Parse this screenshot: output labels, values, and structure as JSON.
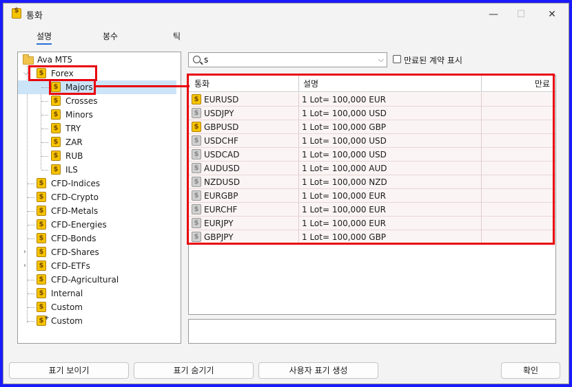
{
  "window": {
    "title": "통화",
    "minimize": "—",
    "maximize": "☐",
    "close": "✕"
  },
  "tabs": [
    "설명",
    "봉수",
    "틱"
  ],
  "tree": {
    "root": "Ava MT5",
    "forex": "Forex",
    "forex_children": [
      "Majors",
      "Crosses",
      "Minors",
      "TRY",
      "ZAR",
      "RUB",
      "ILS"
    ],
    "groups": [
      "CFD-Indices",
      "CFD-Crypto",
      "CFD-Metals",
      "CFD-Energies",
      "CFD-Bonds",
      "CFD-Shares",
      "CFD-ETFs",
      "CFD-Agricultural",
      "Internal",
      "Custom",
      "Custom"
    ]
  },
  "search": {
    "value": "s"
  },
  "expired_checkbox_label": "만료된 계약 표시",
  "table": {
    "headers": [
      "통화",
      "설명",
      "만료"
    ],
    "rows": [
      {
        "symbol": "EURUSD",
        "desc": "1 Lot= 100,000 EUR",
        "expiry": "",
        "active": true
      },
      {
        "symbol": "USDJPY",
        "desc": "1 Lot= 100,000 USD",
        "expiry": "",
        "active": false
      },
      {
        "symbol": "GBPUSD",
        "desc": "1 Lot= 100,000 GBP",
        "expiry": "",
        "active": true
      },
      {
        "symbol": "USDCHF",
        "desc": "1 Lot= 100,000 USD",
        "expiry": "",
        "active": false
      },
      {
        "symbol": "USDCAD",
        "desc": "1 Lot= 100,000 USD",
        "expiry": "",
        "active": false
      },
      {
        "symbol": "AUDUSD",
        "desc": "1 Lot= 100,000 AUD",
        "expiry": "",
        "active": false
      },
      {
        "symbol": "NZDUSD",
        "desc": "1 Lot= 100,000 NZD",
        "expiry": "",
        "active": false
      },
      {
        "symbol": "EURGBP",
        "desc": "1 Lot= 100,000 EUR",
        "expiry": "",
        "active": false
      },
      {
        "symbol": "EURCHF",
        "desc": "1 Lot= 100,000 EUR",
        "expiry": "",
        "active": false
      },
      {
        "symbol": "EURJPY",
        "desc": "1 Lot= 100,000 EUR",
        "expiry": "",
        "active": false
      },
      {
        "symbol": "GBPJPY",
        "desc": "1 Lot= 100,000 GBP",
        "expiry": "",
        "active": false
      }
    ]
  },
  "buttons": {
    "show": "표기 보이기",
    "hide": "표기 숨기기",
    "create": "사용자 표기 생성",
    "ok": "확인"
  },
  "colors": {
    "highlight": "#e8000b",
    "coin": "#f5c400",
    "tab_underline": "#2a6fd6",
    "frame": "#1a1aff"
  }
}
